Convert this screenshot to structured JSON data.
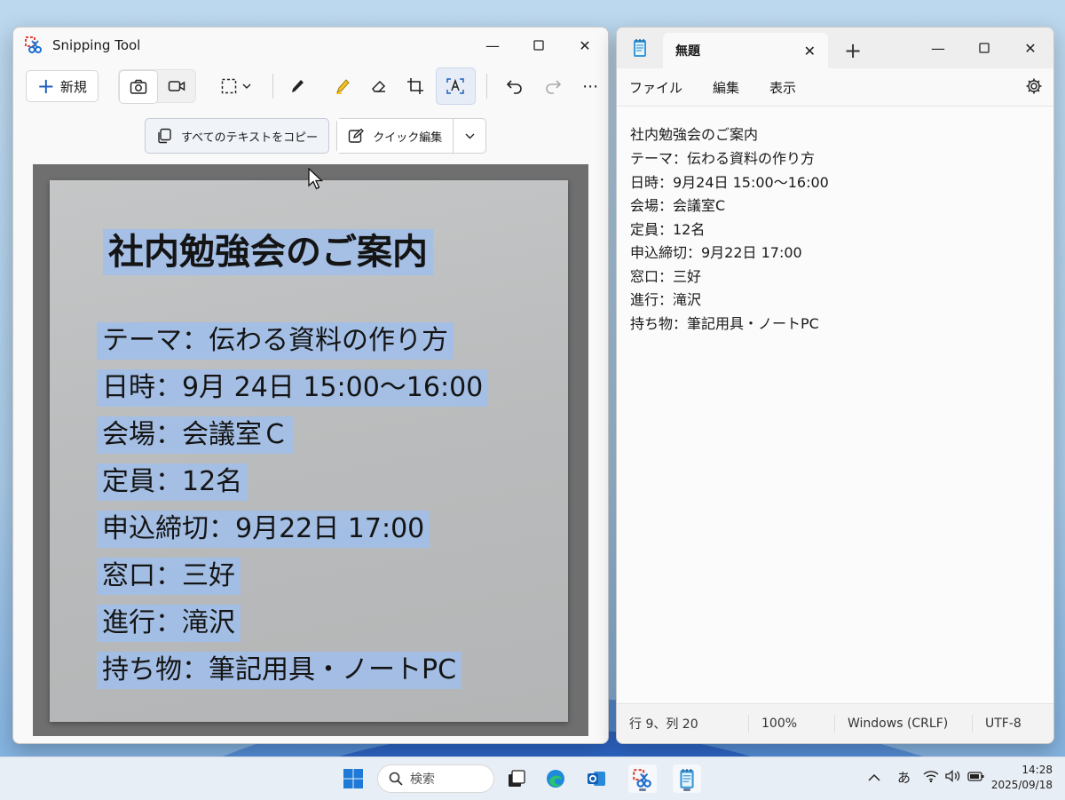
{
  "snipping_tool": {
    "title": "Snipping Tool",
    "new_label": "新規",
    "copy_all_text_label": "すべてのテキストをコピー",
    "quick_edit_label": "クイック編集",
    "capture": {
      "title": "社内勉強会のご案内",
      "lines": [
        "テーマ：伝わる資料の作り方",
        "日時：9月 24日 15:00～16:00",
        "会場：会議室Ｃ",
        "定員：12名",
        "申込締切：9月22日 17:00",
        "窓口：三好",
        "進行：滝沢",
        "持ち物：筆記用具・ノートPC"
      ]
    }
  },
  "notepad": {
    "tab_title": "無題",
    "menu": [
      "ファイル",
      "編集",
      "表示"
    ],
    "lines": [
      "社内勉強会のご案内",
      "テーマ：伝わる資料の作り方",
      "日時：9月24日 15:00～16:00",
      "会場：会議室C",
      "定員：12名",
      "申込締切：9月22日 17:00",
      "窓口：三好",
      "進行：滝沢",
      "持ち物：筆記用具・ノートPC"
    ],
    "status": {
      "position": "行 9、列 20",
      "zoom": "100%",
      "line_ending": "Windows (CRLF)",
      "encoding": "UTF-8"
    }
  },
  "taskbar": {
    "search_placeholder": "検索",
    "ime": "あ",
    "time": "14:28",
    "date": "2025/09/18"
  }
}
